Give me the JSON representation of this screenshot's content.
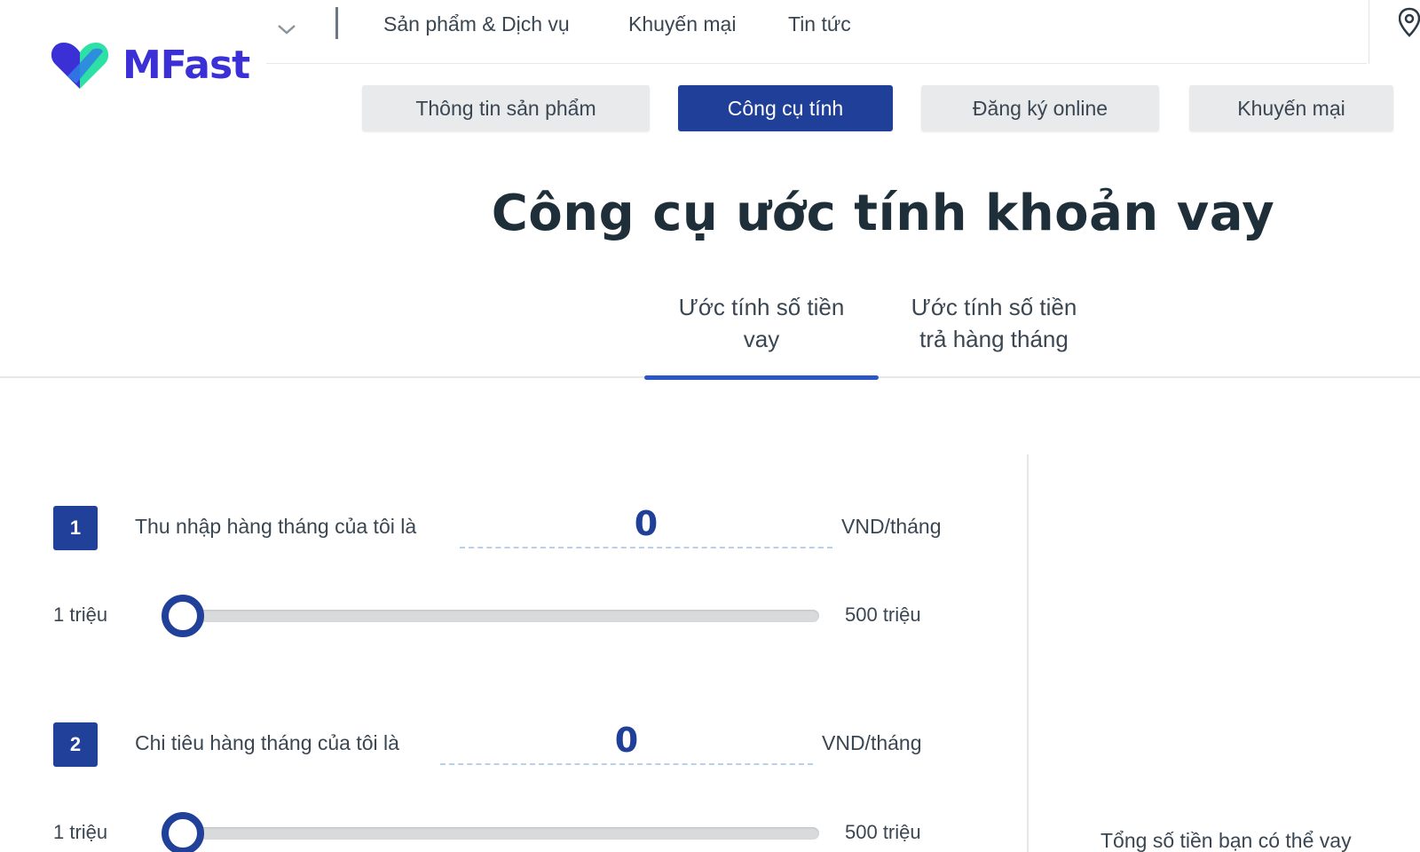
{
  "brand": {
    "name": "MFast",
    "primary": "#3b2fd6",
    "accent": "#1f3f98"
  },
  "top_nav": {
    "links": [
      "Sản phẩm & Dịch vụ",
      "Khuyến mại",
      "Tin tức"
    ],
    "dropdown_icon": "chevron-down-icon",
    "right_icon": "location-pin-icon"
  },
  "sub_tabs": [
    {
      "label": "Thông tin sản phẩm",
      "active": false
    },
    {
      "label": "Công cụ tính",
      "active": true
    },
    {
      "label": "Đăng ký online",
      "active": false
    },
    {
      "label": "Khuyến mại",
      "active": false
    }
  ],
  "page_title": "Công cụ ước tính khoản vay",
  "calc_tabs": [
    {
      "line1": "Ước tính số tiền",
      "line2": "vay",
      "active": true
    },
    {
      "line1": "Ước tính số tiền",
      "line2": "trả hàng tháng",
      "active": false
    }
  ],
  "steps": [
    {
      "number": "1",
      "label": "Thu nhập hàng tháng của tôi là",
      "value": "0",
      "unit": "VND/tháng",
      "range_min": "1 triệu",
      "range_max": "500 triệu",
      "slider_fraction": 0
    },
    {
      "number": "2",
      "label": "Chi tiêu hàng tháng của tôi là",
      "value": "0",
      "unit": "VND/tháng",
      "range_min": "1 triệu",
      "range_max": "500 triệu",
      "slider_fraction": 0
    }
  ],
  "result": {
    "label": "Tổng số tiền bạn có thể vay"
  }
}
